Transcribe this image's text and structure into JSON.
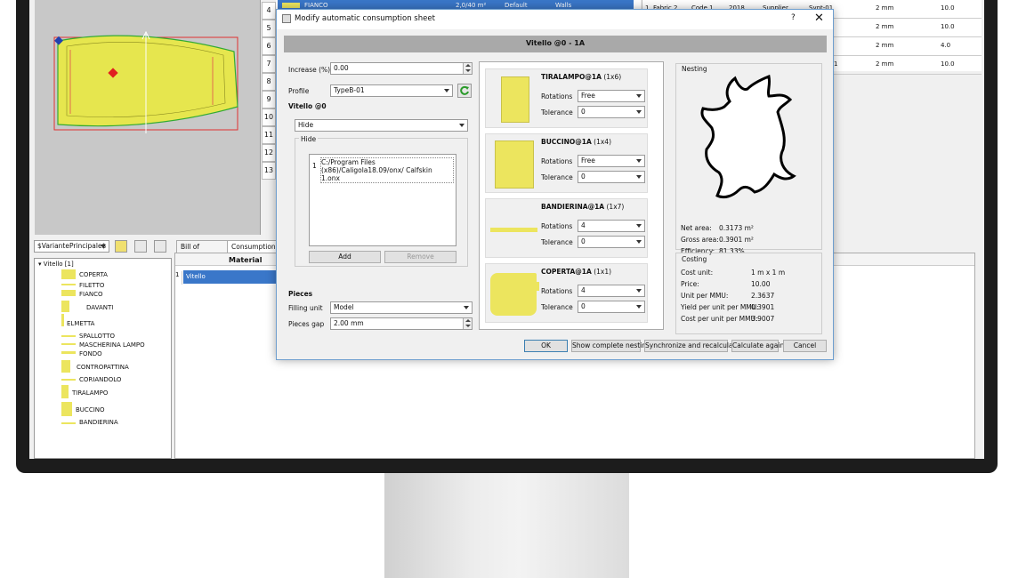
{
  "background": {
    "grid_numbers": [
      "4",
      "5",
      "6",
      "7",
      "8",
      "9",
      "10",
      "11",
      "12",
      "13"
    ],
    "top_row": {
      "name": "FIANCO",
      "col2": "2,0/40 m²",
      "col3": "Default",
      "col4": "Walls"
    },
    "right_rows": [
      {
        "c1": "1",
        "c2": "Fabric 2",
        "c3": "Code 1",
        "c4": "2018",
        "c5": "Supplier",
        "c6": "Synt-01",
        "c7": "2 mm",
        "c8": "10.0"
      },
      {
        "c1": "",
        "c2": "",
        "c3": "",
        "c4": "",
        "c5": "",
        "c6": "",
        "c7": "2 mm",
        "c8": "10.0"
      },
      {
        "c1": "",
        "c2": "",
        "c3": "",
        "c4": "",
        "c5": "",
        "c6": "",
        "c7": "2 mm",
        "c8": "4.0"
      },
      {
        "c1": "",
        "c2": "",
        "c3": "",
        "c4": "",
        "c5": "",
        "c6": "1",
        "c7": "2 mm",
        "c8": "10.0"
      }
    ],
    "variant_combo": "$VariantePrincipale$",
    "tabs": [
      "Bill of Materials",
      "Consumption s"
    ],
    "material_header": "Material",
    "material_row": {
      "num": "1",
      "name": "Vitello"
    },
    "tree_root": "Vitello [1]",
    "tree_items": [
      "COPERTA",
      "FILETTO",
      "FIANCO",
      "DAVANTI",
      "ELMETTA",
      "SPALLOTTO",
      "MASCHERINA LAMPO",
      "FONDO",
      "CONTROPATTINA",
      "CORIANDOLO",
      "TIRALAMPO",
      "BUCCINO",
      "BANDIERINA"
    ]
  },
  "dialog": {
    "title": "Modify automatic consumption sheet",
    "help": "?",
    "close": "✕",
    "header": "Vitello @0 - 1A",
    "increase_label": "Increase (%)",
    "increase_value": "0.00",
    "profile_label": "Profile",
    "profile_value": "TypeB-01",
    "section_title": "Vitello @0",
    "material_type": "Hide",
    "hide_group": "Hide",
    "hide_entry_num": "1",
    "hide_entry_path": "C:/Program Files (x86)/Caligola18.09/onx/ Calfskin 1.onx",
    "add_button": "Add",
    "remove_button": "Remove",
    "pieces_title": "Pieces",
    "filling_unit_label": "Filling unit",
    "filling_unit_value": "Model",
    "pieces_gap_label": "Pieces gap",
    "pieces_gap_value": "2.00 mm",
    "pieces": [
      {
        "name": "TIRALAMPO@1A",
        "count": "(1x6)",
        "rotations": "Free",
        "tolerance": "0"
      },
      {
        "name": "BUCCINO@1A",
        "count": "(1x4)",
        "rotations": "Free",
        "tolerance": "0"
      },
      {
        "name": "BANDIERINA@1A",
        "count": "(1x7)",
        "rotations": "4",
        "tolerance": "0"
      },
      {
        "name": "COPERTA@1A",
        "count": "(1x1)",
        "rotations": "4",
        "tolerance": "0"
      }
    ],
    "rotations_label": "Rotations",
    "tolerance_label": "Tolerance",
    "nesting_title": "Nesting",
    "nesting_stats": [
      {
        "label": "Net area:",
        "value": "0.3173 m²"
      },
      {
        "label": "Gross area:",
        "value": "0.3901 m²"
      },
      {
        "label": "Efficiency:",
        "value": "81.33%"
      }
    ],
    "costing_title": "Costing",
    "costing": [
      {
        "label": "Cost unit:",
        "value": "1 m x 1 m"
      },
      {
        "label": "Price:",
        "value": "10.00"
      },
      {
        "label": "Unit per MMU:",
        "value": "2.3637"
      },
      {
        "label": "Yield per unit per MMU:",
        "value": "0.3901"
      },
      {
        "label": "Cost per unit per MMU:",
        "value": "3.9007"
      }
    ],
    "buttons": {
      "ok": "OK",
      "show_nesting": "Show complete nesting",
      "sync": "Synchronize and recalculate",
      "calc": "Calculate again",
      "cancel": "Cancel"
    }
  },
  "colors": {
    "piece_yellow": "#ece55e",
    "selection_blue": "#3a77c9",
    "header_gray": "#a9a9a9"
  }
}
